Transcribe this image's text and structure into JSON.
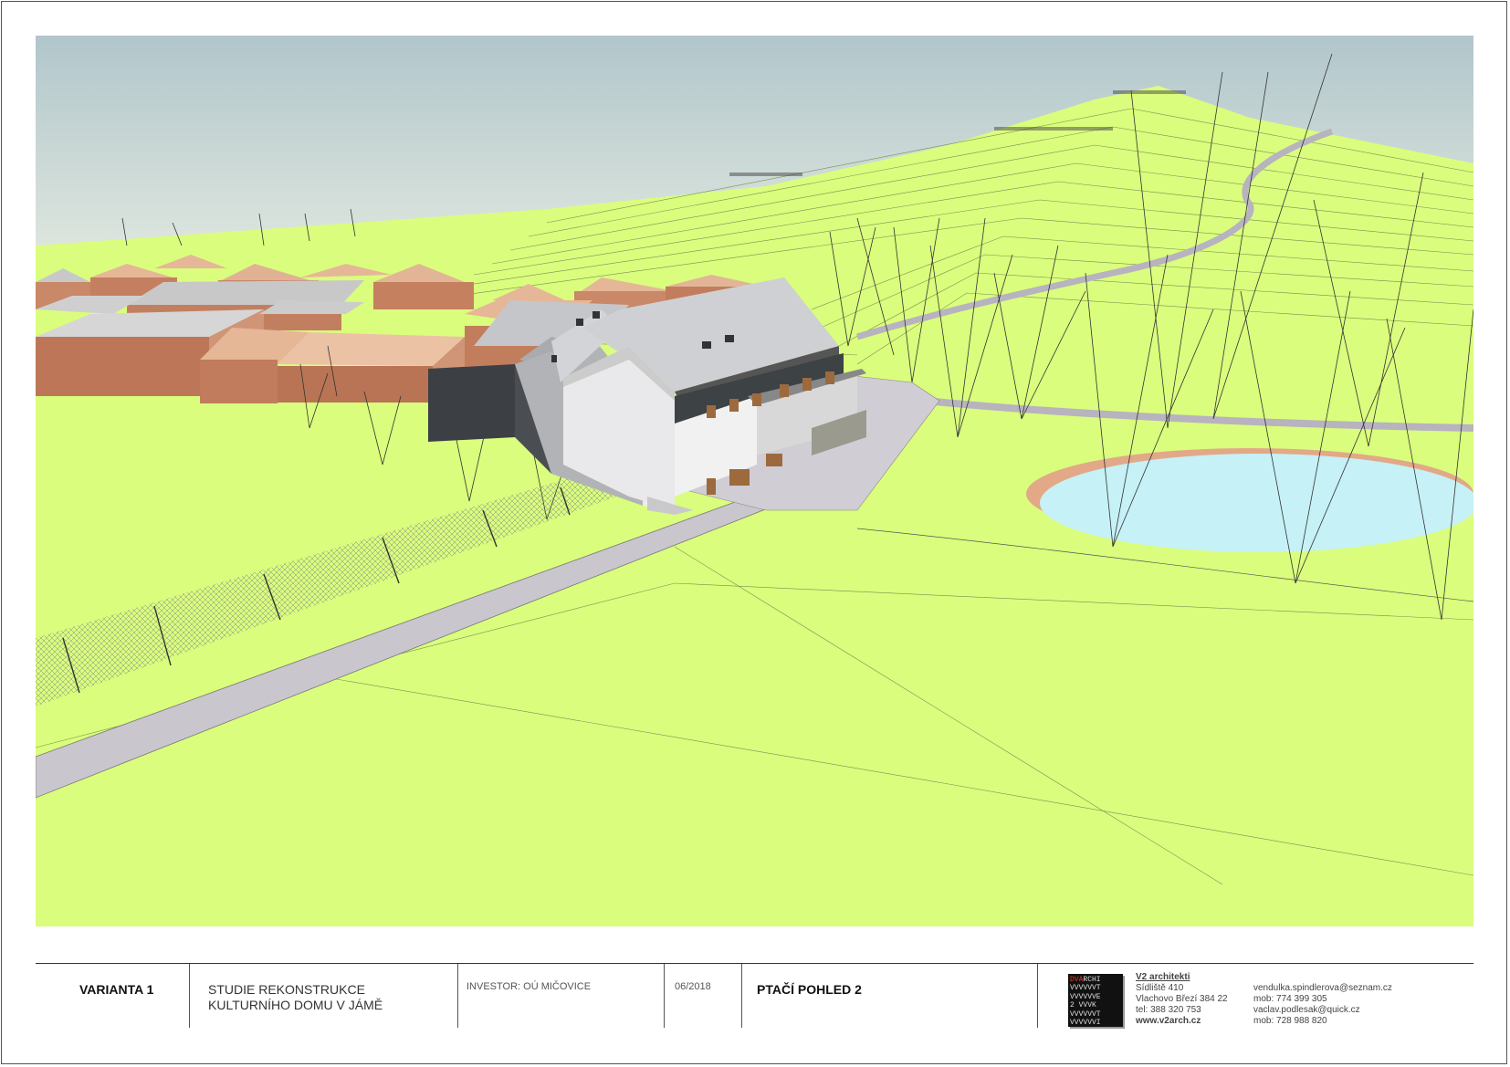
{
  "title_block": {
    "variant": "VARIANTA 1",
    "project_line1": "STUDIE REKONSTRUKCE",
    "project_line2": "KULTURNÍHO DOMU V JÁMĚ",
    "investor": "INVESTOR: OÚ MIČOVICE",
    "date": "06/2018",
    "view_name": "PTAČÍ POHLED 2"
  },
  "logo": {
    "lines": [
      "DVARCHI",
      "VVVVVVT",
      "VVVVVVE",
      "2 VVVK",
      "VVVVVVT",
      "VVVVVVI"
    ]
  },
  "firm": {
    "name": "V2 architekti",
    "address_line1": "Sídliště 410",
    "address_line2": "Vlachovo Březí 384 22",
    "phone": "tel: 388 320 753",
    "web": "www.v2arch.cz"
  },
  "contacts": [
    "vendulka.spindlerova@seznam.cz",
    "mob: 774 399 305",
    "vaclav.podlesak@quick.cz",
    "mob: 728 988 820"
  ],
  "colors": {
    "grass": "#dafd7d",
    "sky_top": "#b4c9cd",
    "sky_bottom": "#dfe6df",
    "road": "#c9c6ce",
    "pond": "#c6f1f6",
    "roof_metal": "#c9cacd",
    "roof_tile": "#e5b797"
  }
}
